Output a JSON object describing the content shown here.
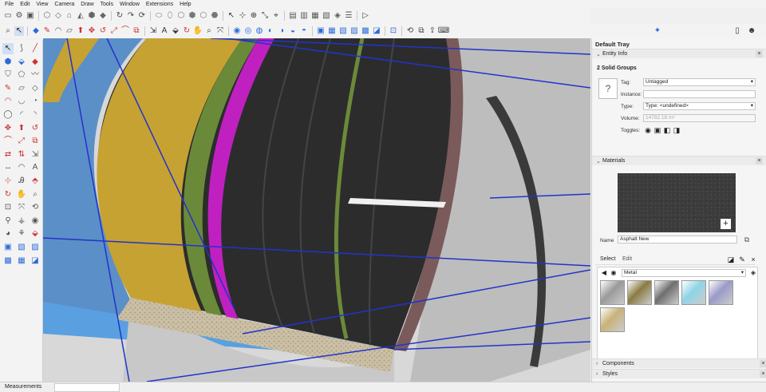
{
  "menu": [
    "File",
    "Edit",
    "View",
    "Camera",
    "Draw",
    "Tools",
    "Window",
    "Extensions",
    "Help"
  ],
  "tray": {
    "title": "Default Tray",
    "entity_info": {
      "header": "Entity Info",
      "selection": "2 Solid Groups",
      "tag_label": "Tag:",
      "tag_value": "Untagged",
      "instance_label": "Instance:",
      "instance_value": "",
      "type_label": "Type:",
      "type_value": "Type: <undefined>",
      "volume_label": "Volume:",
      "volume_value": "14782.18 m³",
      "toggles_label": "Toggles:"
    },
    "materials": {
      "header": "Materials",
      "name_label": "Name",
      "name_value": "Asphalt New",
      "tab_select": "Select",
      "tab_edit": "Edit",
      "library": "Metal",
      "swatch_colors": [
        "#9a9a9a",
        "#8a7b45",
        "#6e6e6e",
        "#8fd4e6",
        "#9a9ac8",
        "#c8b27a"
      ]
    },
    "components": "Components",
    "styles": "Styles"
  },
  "status": {
    "measurements_label": "Measurements",
    "measurements_value": ""
  },
  "icons": {
    "help": "?",
    "close": "×",
    "chev_down": "⌄",
    "chev_right": "›",
    "add": "+",
    "dropdown": "▾"
  }
}
